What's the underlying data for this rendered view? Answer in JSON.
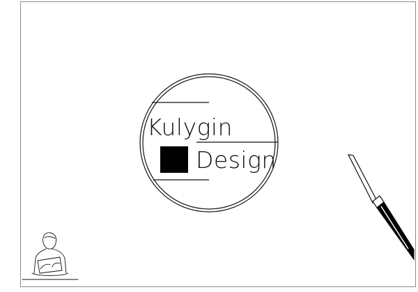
{
  "logo": {
    "word_top": "Kulygin",
    "word_bottom": "Design"
  },
  "colors": {
    "ink": "#111111",
    "frame": "#8a8a8a",
    "background": "#ffffff"
  },
  "icons": {
    "pen": "pen-icon",
    "person": "person-with-tablet-icon"
  }
}
